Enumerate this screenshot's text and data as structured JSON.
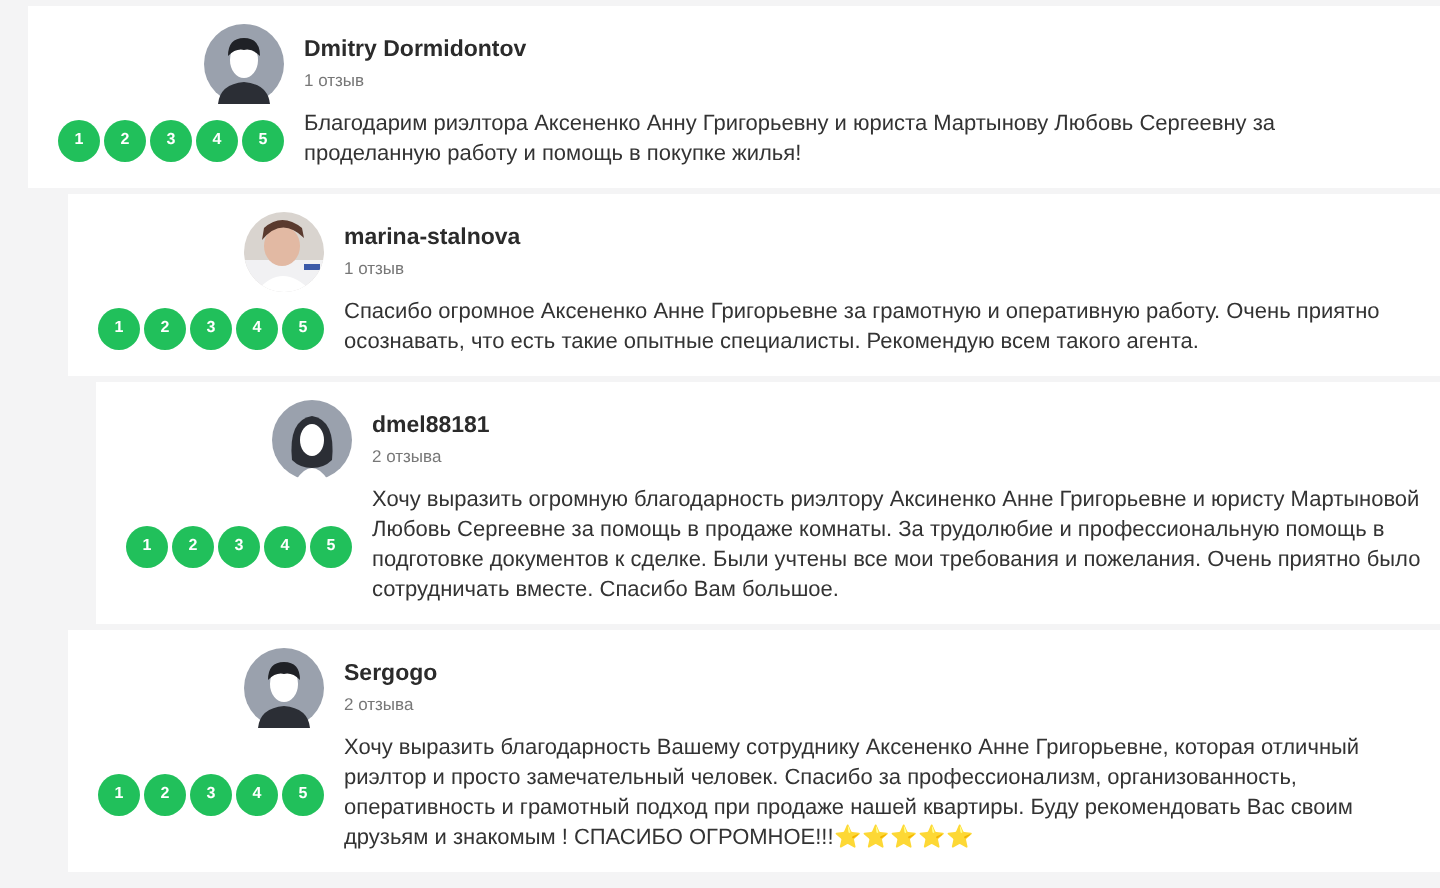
{
  "reviews": [
    {
      "author": "Dmitry Dormidontov",
      "count": "1 отзыв",
      "avatar": {
        "kind": "silhouette"
      },
      "scale": [
        "1",
        "2",
        "3",
        "4",
        "5"
      ],
      "text": "Благодарим риэлтора Аксененко Анну Григорьевну и юриста Мартынову Любовь Сергеевну за проделанную работу и помощь в покупке жилья!"
    },
    {
      "author": "marina-stalnova",
      "count": "1 отзыв",
      "scale": [
        "1",
        "2",
        "3",
        "4",
        "5"
      ],
      "text": "Спасибо огромное Аксененко Анне Григорьевне за грамотную и оперативную работу. Очень приятно осознавать, что есть такие опытные специалисты. Рекомендую всем такого агента."
    },
    {
      "author": "dmel88181",
      "count": "2 отзыва",
      "avatar": {
        "kind": "female"
      },
      "scale": [
        "1",
        "2",
        "3",
        "4",
        "5"
      ],
      "text": "Хочу выразить огромную благодарность риэлтору Аксиненко Анне Григорьевне и юристу Мартыновой Любовь Сергеевне за помощь в продаже комнаты. За трудолюбие и профессиональную помощь в подготовке документов к сделке. Были учтены все мои требования и пожелания. Очень приятно было сотрудничать вместе. Спасибо Вам большое."
    },
    {
      "author": "Sergogo",
      "count": "2 отзыва",
      "avatar": {
        "kind": "silhouette"
      },
      "scale": [
        "1",
        "2",
        "3",
        "4",
        "5"
      ],
      "text": "Хочу выразить благодарность Вашему сотруднику Аксененко Анне Григорьевне, которая отличный риэлтор и просто замечательный человек. Спасибо за профессионализм, организованность, оперативность и грамотный подход при продаже нашей квартиры. Буду рекомендовать Вас своим друзьям и знакомым ! СПАСИБО ОГРОМНОЕ!!!⭐⭐⭐⭐⭐"
    }
  ]
}
